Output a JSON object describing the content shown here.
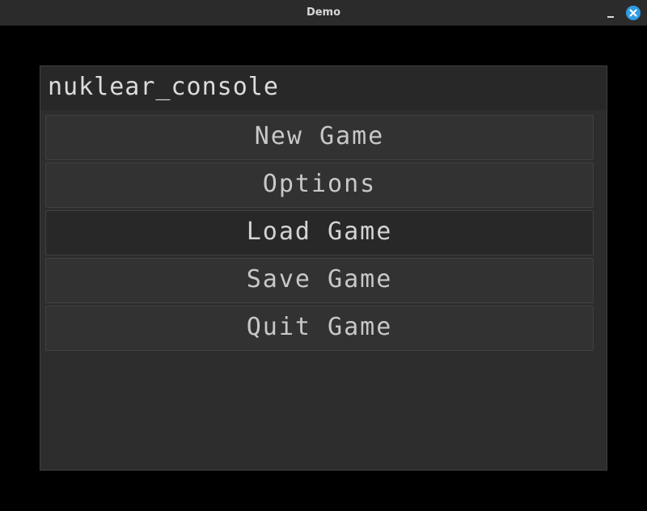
{
  "window": {
    "title": "Demo",
    "controls": {
      "minimize": "minimize-icon",
      "close": "close-icon"
    }
  },
  "panel": {
    "title": "nuklear_console"
  },
  "menu": {
    "items": [
      {
        "label": "New Game"
      },
      {
        "label": "Options"
      },
      {
        "label": "Load Game",
        "active": true
      },
      {
        "label": "Save Game"
      },
      {
        "label": "Quit Game"
      }
    ]
  },
  "colors": {
    "background": "#000000",
    "titlebar": "#2b2b2b",
    "panel": "#2d2d2d",
    "button": "#323232",
    "button_active": "#282828",
    "close_button": "#2f9be4",
    "text": "#c8c8c8"
  }
}
